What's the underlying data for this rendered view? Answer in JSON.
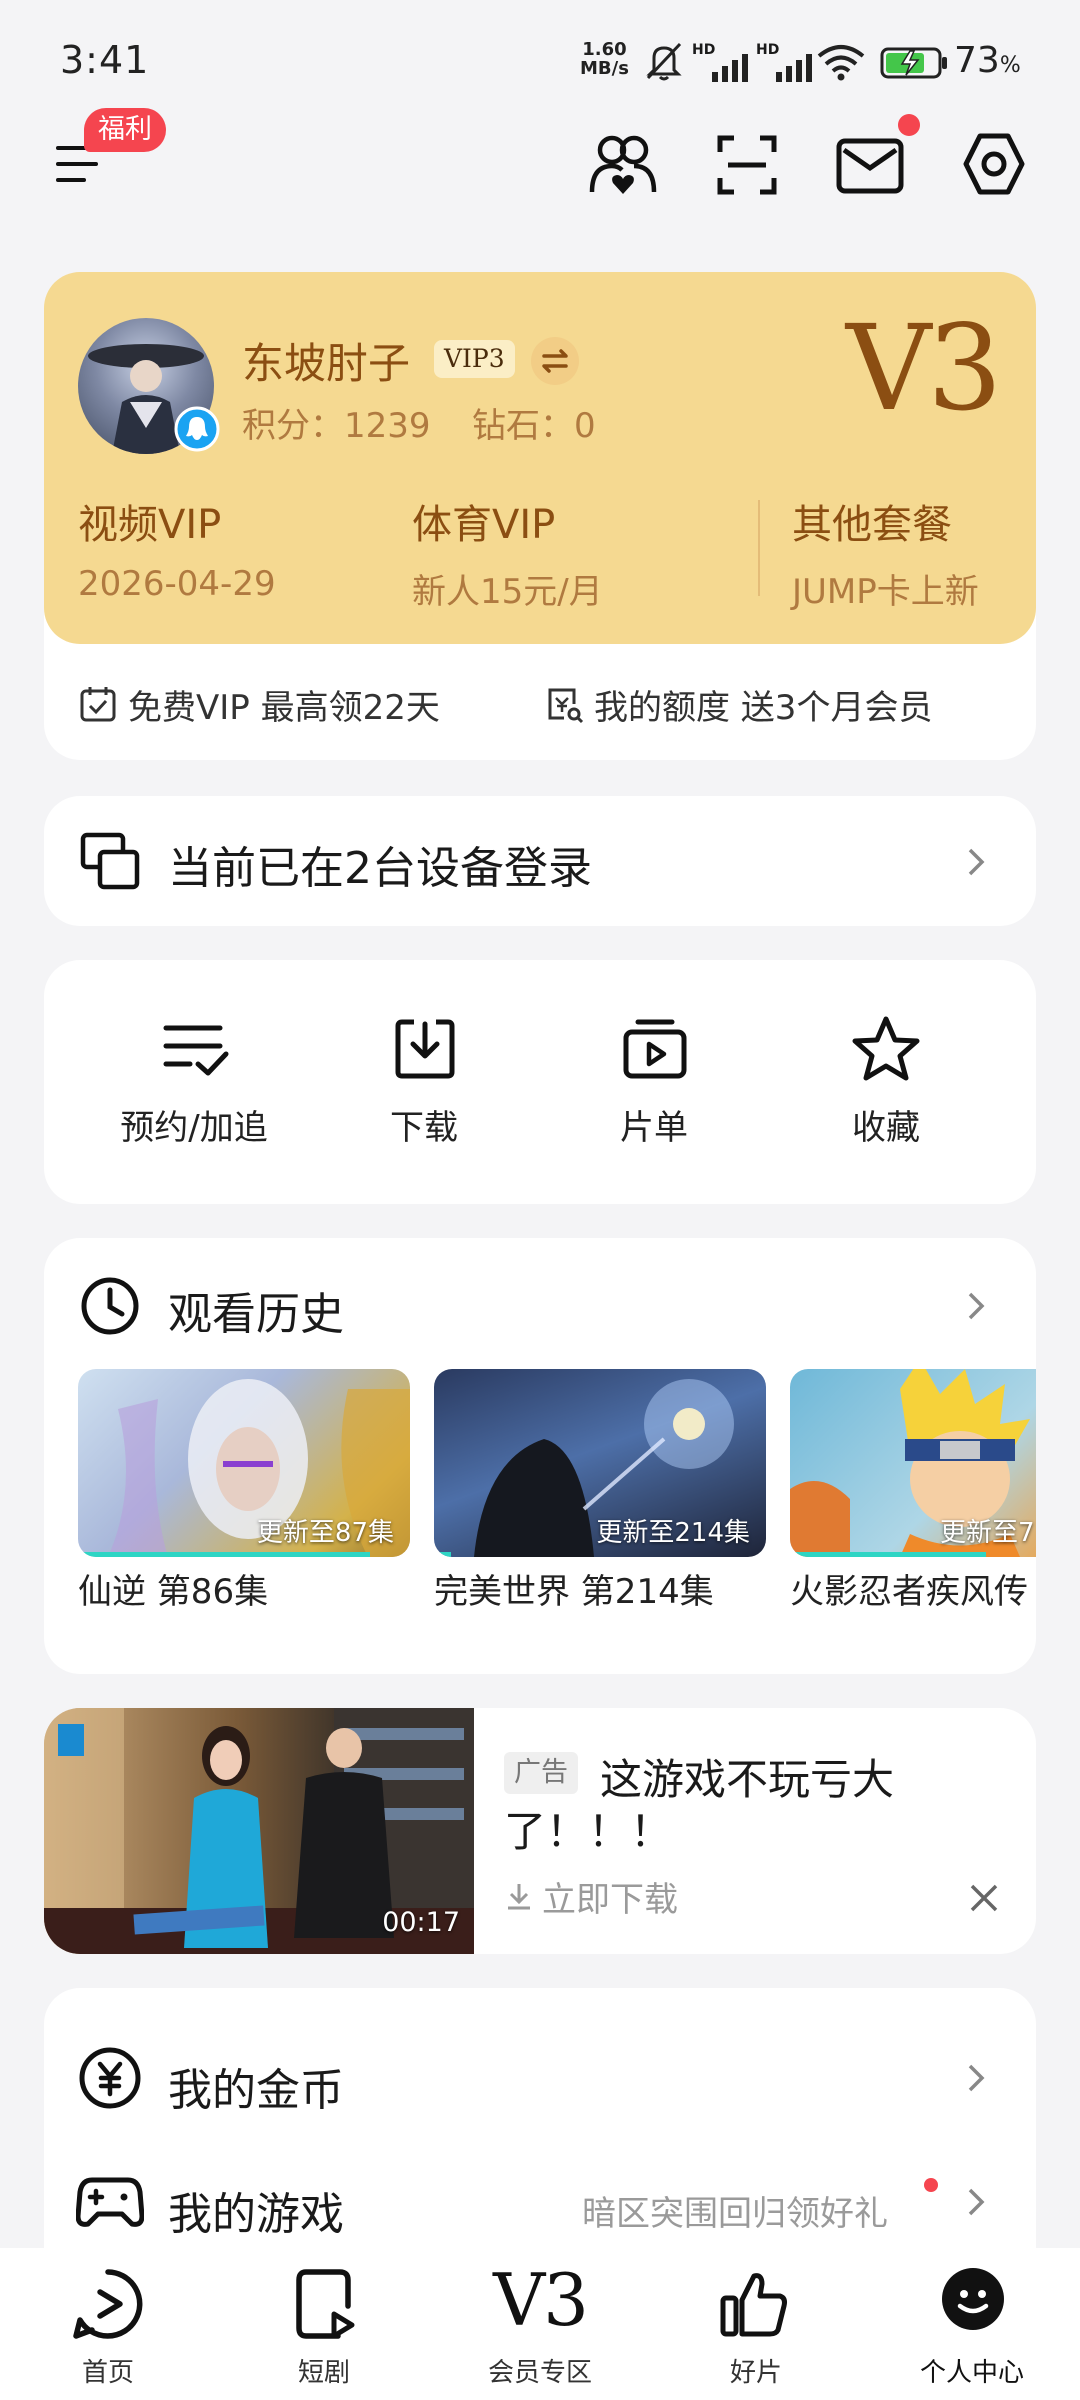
{
  "status_bar": {
    "time": "3:41",
    "speed_value": "1.60",
    "speed_unit": "MB/s",
    "network1": "HD",
    "network2": "HD",
    "battery": "73",
    "battery_unit": "%"
  },
  "header": {
    "welfare_badge": "福利",
    "icons": [
      "menu-icon",
      "friends-icon",
      "scan-icon",
      "mail-icon",
      "settings-icon"
    ]
  },
  "profile": {
    "username": "东坡肘子",
    "vip_badge": "VIP3",
    "points_label": "积分：1239",
    "diamonds_label": "钻石：0",
    "level": "V3",
    "plans": [
      {
        "title": "视频VIP",
        "sub": "2026-04-29"
      },
      {
        "title": "体育VIP",
        "sub": "新人15元/月"
      },
      {
        "title": "其他套餐",
        "sub": "JUMP卡上新"
      }
    ],
    "perks": [
      {
        "text": "免费VIP 最高领22天"
      },
      {
        "text": "我的额度 送3个月会员"
      }
    ],
    "colors": {
      "card": "#f5d991",
      "title": "#8b4e12",
      "sub": "#b07a40"
    }
  },
  "devices": {
    "label": "当前已在2台设备登录"
  },
  "quick_menu": [
    {
      "label": "预约/加追",
      "icon": "checklist-icon"
    },
    {
      "label": "下载",
      "icon": "download-icon"
    },
    {
      "label": "片单",
      "icon": "playlist-icon"
    },
    {
      "label": "收藏",
      "icon": "star-icon"
    }
  ],
  "history": {
    "title": "观看历史",
    "items": [
      {
        "title": "仙逆 第86集",
        "badge": "更新至87集",
        "progress": 0.88
      },
      {
        "title": "完美世界 第214集",
        "badge": "更新至214集",
        "progress": 0.05
      },
      {
        "title": "火影忍者疾风传",
        "badge": "更新至7",
        "progress": 0.7
      }
    ]
  },
  "ad": {
    "tag": "广告",
    "title_line1": "这游戏不玩亏大",
    "title_line2": "了！！！",
    "cta": "立即下载",
    "duration": "00:17"
  },
  "list": [
    {
      "label": "我的金币",
      "extra": ""
    },
    {
      "label": "我的游戏",
      "extra": "暗区突围回归领好礼"
    }
  ],
  "bottom_nav": [
    {
      "label": "首页"
    },
    {
      "label": "短剧"
    },
    {
      "label": "会员专区",
      "glyph": "V3"
    },
    {
      "label": "好片"
    },
    {
      "label": "个人中心",
      "active": true
    }
  ],
  "accent_red": "#f5454f",
  "accent_teal": "#2ed5c4"
}
